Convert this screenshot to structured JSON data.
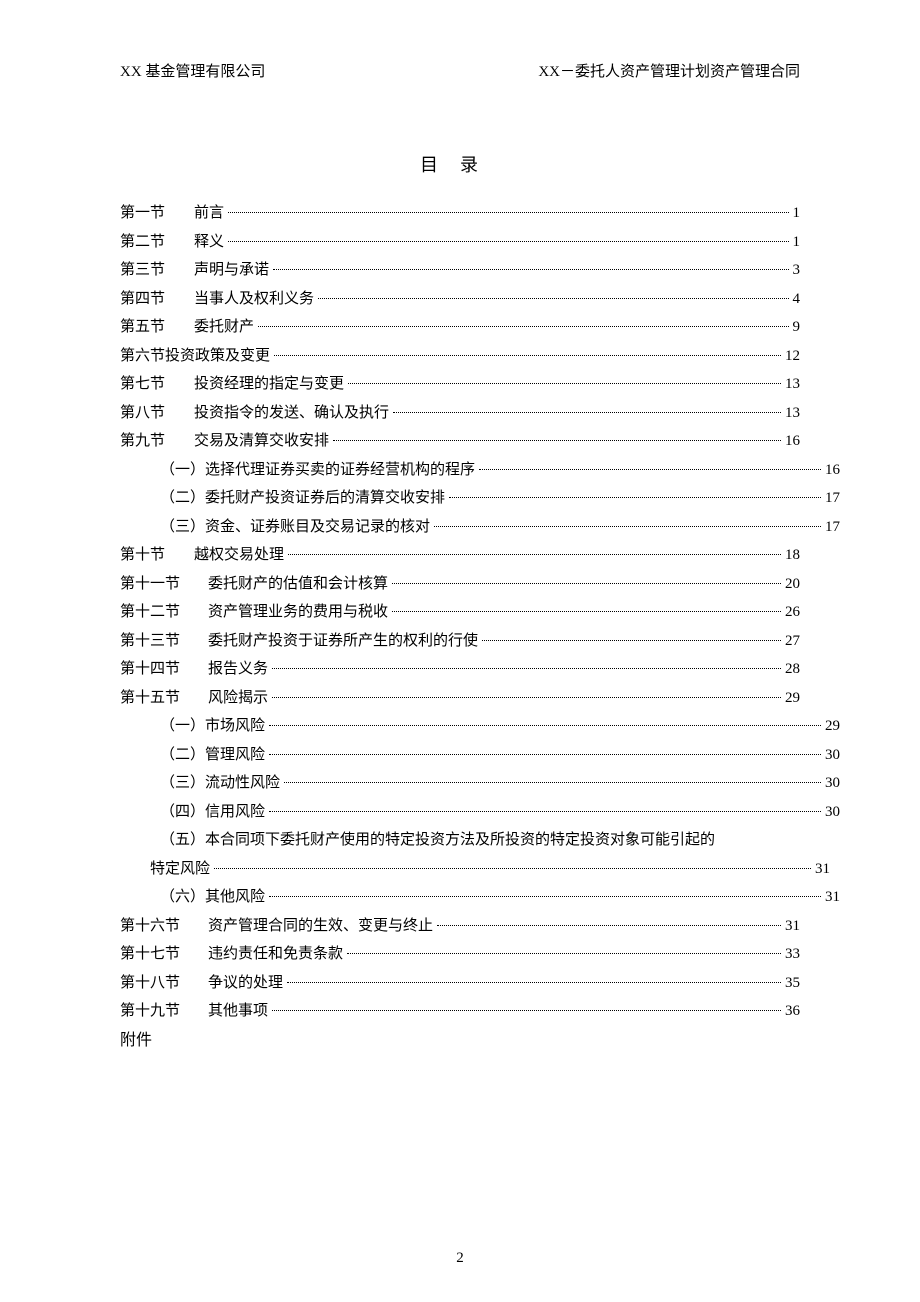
{
  "header": {
    "left": "XX 基金管理有限公司",
    "right": "XX－委托人资产管理计划资产管理合同"
  },
  "title": "目录",
  "toc": [
    {
      "label": "第一节",
      "title": "前言",
      "page": "1",
      "indent": 0,
      "gap": true
    },
    {
      "label": "第二节",
      "title": "释义",
      "page": "1",
      "indent": 0,
      "gap": true
    },
    {
      "label": "第三节",
      "title": "声明与承诺",
      "page": "3",
      "indent": 0,
      "gap": true
    },
    {
      "label": "第四节",
      "title": "当事人及权利义务",
      "page": "4",
      "indent": 0,
      "gap": true
    },
    {
      "label": "第五节",
      "title": "委托财产",
      "page": "9",
      "indent": 0,
      "gap": true
    },
    {
      "label": "第六节",
      "title": "投资政策及变更",
      "page": "12",
      "indent": 0,
      "gap": false
    },
    {
      "label": "第七节",
      "title": "投资经理的指定与变更",
      "page": "13",
      "indent": 0,
      "gap": true
    },
    {
      "label": "第八节",
      "title": "投资指令的发送、确认及执行",
      "page": "13",
      "indent": 0,
      "gap": true
    },
    {
      "label": "第九节",
      "title": "交易及清算交收安排",
      "page": "16",
      "indent": 0,
      "gap": true
    },
    {
      "label": "（一）",
      "title": "选择代理证券买卖的证券经营机构的程序",
      "page": "16",
      "indent": 1,
      "gap": false
    },
    {
      "label": "（二）",
      "title": "委托财产投资证券后的清算交收安排",
      "page": "17",
      "indent": 1,
      "gap": false
    },
    {
      "label": "（三）",
      "title": "资金、证券账目及交易记录的核对",
      "page": "17",
      "indent": 1,
      "gap": false
    },
    {
      "label": "第十节",
      "title": "越权交易处理",
      "page": "18",
      "indent": 0,
      "gap": true
    },
    {
      "label": "第十一节",
      "title": "委托财产的估值和会计核算",
      "page": "20",
      "indent": 0,
      "gap": true
    },
    {
      "label": "第十二节",
      "title": "资产管理业务的费用与税收",
      "page": "26",
      "indent": 0,
      "gap": true
    },
    {
      "label": "第十三节",
      "title": "委托财产投资于证券所产生的权利的行使",
      "page": "27",
      "indent": 0,
      "gap": true
    },
    {
      "label": "第十四节",
      "title": "报告义务",
      "page": "28",
      "indent": 0,
      "gap": true
    },
    {
      "label": "第十五节",
      "title": "风险揭示",
      "page": "29",
      "indent": 0,
      "gap": true
    },
    {
      "label": "（一）",
      "title": "市场风险",
      "page": "29",
      "indent": 1,
      "gap": false,
      "spaceAfter": true
    },
    {
      "label": "（二）",
      "title": "管理风险",
      "page": "30",
      "indent": 1,
      "gap": false,
      "spaceAfter": true
    },
    {
      "label": "（三）",
      "title": "流动性风险",
      "page": "30",
      "indent": 1,
      "gap": false,
      "spaceAfter": true
    },
    {
      "label": "（四）",
      "title": "信用风险",
      "page": "30",
      "indent": 1,
      "gap": false,
      "spaceAfter": true
    }
  ],
  "toc_wrap": {
    "label": "（五）",
    "line1": "本合同项下委托财产使用的特定投资方法及所投资的特定投资对象可能引起的",
    "line2_title": "特定风险",
    "page": "31"
  },
  "toc_after_wrap": [
    {
      "label": "（六）",
      "title": "其他风险",
      "page": "31",
      "indent": 1,
      "gap": false,
      "spaceAfter": true
    },
    {
      "label": "第十六节",
      "title": "资产管理合同的生效、变更与终止",
      "page": "31",
      "indent": 0,
      "gap": true
    },
    {
      "label": "第十七节",
      "title": "违约责任和免责条款",
      "page": "33",
      "indent": 0,
      "gap": true
    },
    {
      "label": "第十八节",
      "title": "争议的处理",
      "page": "35",
      "indent": 0,
      "gap": true
    },
    {
      "label": "第十九节",
      "title": "其他事项",
      "page": "36",
      "indent": 0,
      "gap": true
    }
  ],
  "appendix": "附件",
  "page_number": "2"
}
